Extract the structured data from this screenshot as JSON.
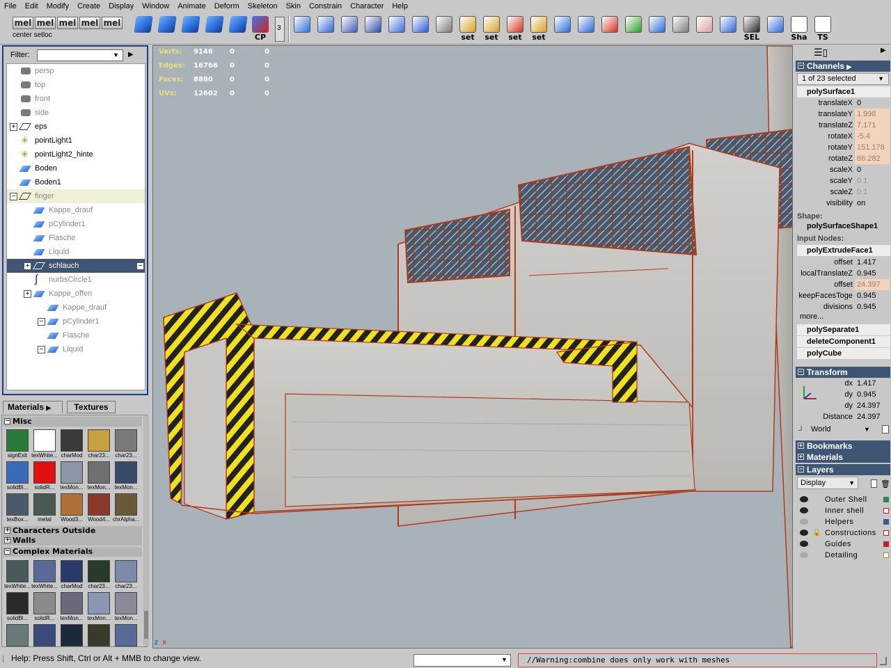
{
  "menubar": [
    "File",
    "Edit",
    "Modify",
    "Create",
    "Display",
    "Window",
    "Animate",
    "Deform",
    "Skeleton",
    "Skin",
    "Constrain",
    "Character",
    "Help"
  ],
  "toolbar": {
    "mel_label": "mel",
    "shelf_caption": "center setloc",
    "spinner_value": "3",
    "labels": {
      "cp": "CP",
      "set": "set",
      "sel": "SEL",
      "sha": "Sha",
      "ts": "TS"
    }
  },
  "outliner": {
    "filter_label": "Filter:",
    "filter_value": "",
    "items": [
      {
        "label": "persp",
        "icon": "camera-icon"
      },
      {
        "label": "top",
        "icon": "camera-icon"
      },
      {
        "label": "front",
        "icon": "camera-icon"
      },
      {
        "label": "side",
        "icon": "camera-icon"
      },
      {
        "label": "eps",
        "icon": "group-icon"
      },
      {
        "label": "pointLight1",
        "icon": "point-light-icon"
      },
      {
        "label": "pointLight2_hinte",
        "icon": "point-light-icon"
      },
      {
        "label": "Boden",
        "icon": "mesh-icon"
      },
      {
        "label": "Boden1",
        "icon": "mesh-icon"
      },
      {
        "label": "finger",
        "icon": "group-icon"
      },
      {
        "label": "Kappe_drauf",
        "icon": "mesh-icon"
      },
      {
        "label": "pCylinder1",
        "icon": "mesh-icon"
      },
      {
        "label": "Flasche",
        "icon": "mesh-icon"
      },
      {
        "label": "Liquid",
        "icon": "mesh-icon"
      },
      {
        "label": "schlauch",
        "icon": "group-icon"
      },
      {
        "label": "nurbsCircle1",
        "icon": "curve-icon"
      },
      {
        "label": "Kappe_offen",
        "icon": "mesh-icon"
      },
      {
        "label": "Kappe_drauf",
        "icon": "mesh-icon"
      },
      {
        "label": "pCylinder1",
        "icon": "mesh-icon"
      },
      {
        "label": "Flasche",
        "icon": "mesh-icon"
      },
      {
        "label": "Liquid",
        "icon": "mesh-icon"
      }
    ]
  },
  "materials": {
    "tabs": [
      "Materials",
      "Textures"
    ],
    "sections": [
      "Misc",
      "Characters Outside",
      "Walls",
      "Complex Materials"
    ],
    "misc_swatches": [
      {
        "label": "signExit",
        "color": "#2a7a3a"
      },
      {
        "label": "texWhite...",
        "color": "#ffffff"
      },
      {
        "label": "charMod",
        "color": "#3a3a3a"
      },
      {
        "label": "char23...",
        "color": "#c8a040"
      },
      {
        "label": "char23...",
        "color": "#7a7a7a"
      },
      {
        "label": "solidBl...",
        "color": "#3a6ab8"
      },
      {
        "label": "solidR...",
        "color": "#e01010"
      },
      {
        "label": "texMon...",
        "color": "#8a96a4"
      },
      {
        "label": "texMon...",
        "color": "#707070"
      },
      {
        "label": "texMon...",
        "color": "#3a4a6a"
      },
      {
        "label": "texBox...",
        "color": "#4a5a6a"
      },
      {
        "label": "metal",
        "color": "#4a5a52"
      },
      {
        "label": "Wood3...",
        "color": "#b0703a"
      },
      {
        "label": "Wood4...",
        "color": "#8a3a2a"
      },
      {
        "label": "chrAlpha...",
        "color": "#6a5a3a"
      }
    ],
    "complex_swatches": [
      {
        "label": "texWhite...",
        "color": "#4a5a5a"
      },
      {
        "label": "texWhite...",
        "color": "#5a6a98"
      },
      {
        "label": "charMod",
        "color": "#2a3a6a"
      },
      {
        "label": "char23...",
        "color": "#2a3a2a"
      },
      {
        "label": "char23...",
        "color": "#7a8aa8"
      },
      {
        "label": "solidBl...",
        "color": "#2a2a2a"
      },
      {
        "label": "solidR...",
        "color": "#8a8a8a"
      },
      {
        "label": "texMon...",
        "color": "#6a6a7a"
      },
      {
        "label": "texMon...",
        "color": "#8a96b4"
      },
      {
        "label": "texMon...",
        "color": "#8a8a98"
      },
      {
        "label": "",
        "color": "#6a7a7a"
      },
      {
        "label": "",
        "color": "#3a4a7a"
      },
      {
        "label": "",
        "color": "#1a2a3a"
      },
      {
        "label": "",
        "color": "#3a3a2a"
      },
      {
        "label": "",
        "color": "#5a6a98"
      }
    ]
  },
  "viewport": {
    "hud": [
      {
        "label": "Verts:",
        "v1": "9146",
        "v2": "0",
        "v3": "0"
      },
      {
        "label": "Edges:",
        "v1": "16766",
        "v2": "0",
        "v3": "0"
      },
      {
        "label": "Faces:",
        "v1": "8880",
        "v2": "0",
        "v3": "0"
      },
      {
        "label": "UVs:",
        "v1": "12602",
        "v2": "0",
        "v3": "0"
      }
    ],
    "axis_labels": {
      "z": "z",
      "x": "x"
    }
  },
  "channelbox": {
    "title": "Channels",
    "selection": "1 of 23 selected",
    "object": "polySurface1",
    "attributes": [
      {
        "name": "translateX",
        "value": "0",
        "state": "normal"
      },
      {
        "name": "translateY",
        "value": "1.998",
        "state": "keyed"
      },
      {
        "name": "translateZ",
        "value": "7.171",
        "state": "keyed"
      },
      {
        "name": "rotateX",
        "value": "-5.4",
        "state": "keyed"
      },
      {
        "name": "rotateY",
        "value": "151.178",
        "state": "keyed"
      },
      {
        "name": "rotateZ",
        "value": "66.282",
        "state": "keyed"
      },
      {
        "name": "scaleX",
        "value": "0",
        "state": "normal"
      },
      {
        "name": "scaleY",
        "value": "0.1",
        "state": "locked"
      },
      {
        "name": "scaleZ",
        "value": "0.1",
        "state": "locked"
      },
      {
        "name": "visibility",
        "value": "on",
        "state": "normal"
      }
    ],
    "shape_label": "Shape:",
    "shape": "polySurfaceShape1",
    "input_label": "Input Nodes:",
    "input_node": "polyExtrudeFace1",
    "input_attrs": [
      {
        "name": "offset",
        "value": "1.417",
        "state": "normal"
      },
      {
        "name": "localTranslateZ",
        "value": "0.945",
        "state": "normal"
      },
      {
        "name": "offset",
        "value": "24.397",
        "state": "keyed"
      },
      {
        "name": "keepFacesToge",
        "value": "0.945",
        "state": "normal"
      },
      {
        "name": "divisions",
        "value": "0.945",
        "state": "normal"
      }
    ],
    "more": "more...",
    "other_nodes": [
      "polySeparate1",
      "deleteComponent1",
      "polyCube"
    ],
    "transform_title": "Transform",
    "transform_attrs": [
      {
        "name": "dx",
        "value": "1.417"
      },
      {
        "name": "dy",
        "value": "0.945"
      },
      {
        "name": "dy",
        "value": "24.397"
      },
      {
        "name": "Distance",
        "value": "24.397"
      }
    ],
    "space": "World",
    "bookmarks": "Bookmarks",
    "materials": "Materials",
    "layers_title": "Layers",
    "layer_display": "Display",
    "layers": [
      {
        "name": "Outer Shell",
        "visible": true,
        "locked": false,
        "color": "#2a8a4a"
      },
      {
        "name": "Inner shell",
        "visible": true,
        "locked": false,
        "color": "#c02020"
      },
      {
        "name": "Helpers",
        "visible": false,
        "locked": false,
        "color": "#3a5a8a"
      },
      {
        "name": "Constructions",
        "visible": true,
        "locked": true,
        "color": "#c02020"
      },
      {
        "name": "Guides",
        "visible": true,
        "locked": false,
        "color": "#c02020"
      },
      {
        "name": "Detailing",
        "visible": false,
        "locked": false,
        "color": "#c88a2a"
      }
    ]
  },
  "statusbar": {
    "help": "Help: Press Shift, Ctrl or Alt + MMB to change view.",
    "warning": "//Warning:combine does only work with meshes"
  }
}
